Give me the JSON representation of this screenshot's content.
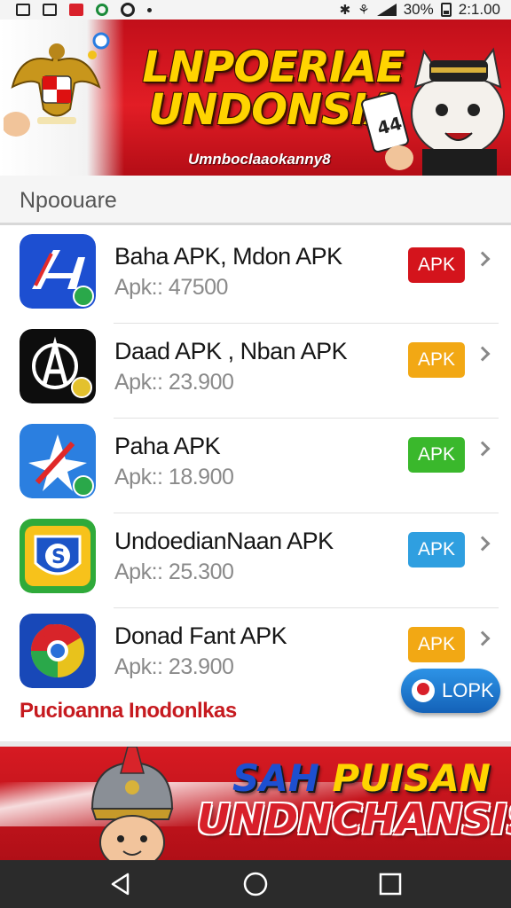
{
  "status_bar": {
    "battery": "30%",
    "time": "2:1.00"
  },
  "top_banner": {
    "title_line1": "LNPOERIAE",
    "title_line2": "UNDONSIA",
    "subtitle": "Umnboclaaokanny8"
  },
  "section": {
    "title": "Npoouare"
  },
  "apps": [
    {
      "name": "Baha APK, Mdon APK",
      "size": "Apk:: 47500",
      "button": "APK",
      "button_color": "#d4141c"
    },
    {
      "name": "Daad APK , Nban APK",
      "size": "Apk:: 23.900",
      "button": "APK",
      "button_color": "#f2a814"
    },
    {
      "name": "Paha APK",
      "size": "Apk:: 18.900",
      "button": "APK",
      "button_color": "#3ab82c"
    },
    {
      "name": "UndoedianNaan APK",
      "size": "Apk:: 25.300",
      "button": "APK",
      "button_color": "#2f9fe0"
    },
    {
      "name": "Donad Fant APK",
      "size": "Apk:: 23.900",
      "button": "APK",
      "button_color": "#f2a814"
    }
  ],
  "footer": {
    "link_text": "Pucioanna Inodonlkas",
    "floating_button": "LOPK"
  },
  "bottom_banner": {
    "line1_word1": "SAH",
    "line1_word2": "PUISAN",
    "line2": "UNDNCHANSIS"
  },
  "icons": {
    "app1": "blue-arrow-app-icon",
    "app2": "black-compass-app-icon",
    "app3": "blue-star-app-icon",
    "app4": "shield-s-app-icon",
    "app5": "chrome-like-app-icon"
  }
}
